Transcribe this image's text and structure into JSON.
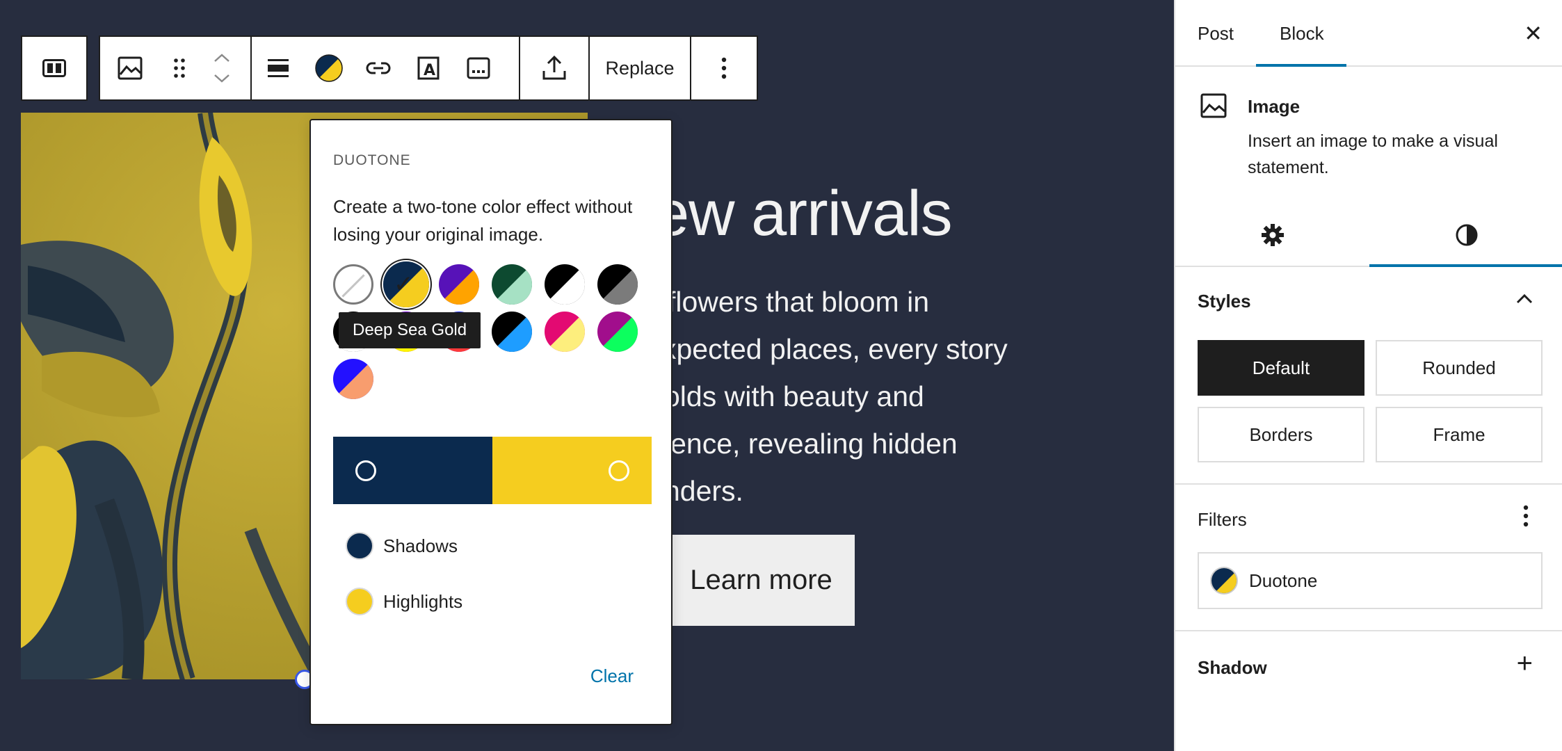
{
  "toolbar": {
    "replace_label": "Replace"
  },
  "hero": {
    "title": "ew arrivals",
    "lines": [
      "flowers that bloom in",
      "xpected places, every story",
      "olds with beauty and",
      "ience, revealing hidden",
      "nders."
    ],
    "button_label": "Learn more"
  },
  "duotone": {
    "heading": "DUOTONE",
    "description": "Create a two-tone color effect without losing your original image.",
    "tooltip": "Deep Sea Gold",
    "swatches": [
      {
        "name": "none",
        "a": "#ffffff",
        "b": "#ffffff"
      },
      {
        "name": "Deep Sea Gold",
        "a": "#0b2a4e",
        "b": "#f5cd1f",
        "selected": true
      },
      {
        "name": "purple-orange",
        "a": "#5712b8",
        "b": "#ffa300"
      },
      {
        "name": "green-mint",
        "a": "#0d4a30",
        "b": "#a6e1c4"
      },
      {
        "name": "black-white",
        "a": "#000000",
        "b": "#ffffff"
      },
      {
        "name": "black-gray",
        "a": "#000000",
        "b": "#7b7b7b"
      },
      {
        "name": "black-white-2",
        "a": "#000000",
        "b": "#ffffff"
      },
      {
        "name": "purple-yellow",
        "a": "#7a00df",
        "b": "#fef400"
      },
      {
        "name": "blue-red",
        "a": "#1b2cff",
        "b": "#ff3a3a"
      },
      {
        "name": "black-cyan",
        "a": "#000000",
        "b": "#1e9dff"
      },
      {
        "name": "magenta-yellow",
        "a": "#e30a72",
        "b": "#fdee7d"
      },
      {
        "name": "magenta-green",
        "a": "#a10e8c",
        "b": "#0cff5e"
      },
      {
        "name": "blue-peach",
        "a": "#2311ff",
        "b": "#f89d6e"
      }
    ],
    "shadows_color": "#0b2a4e",
    "highlights_color": "#f5cd1f",
    "shadows_label": "Shadows",
    "highlights_label": "Highlights",
    "clear_label": "Clear"
  },
  "sidebar": {
    "tab_post": "Post",
    "tab_block": "Block",
    "block_title": "Image",
    "block_desc": "Insert an image to make a visual statement.",
    "styles_title": "Styles",
    "styles": [
      "Default",
      "Rounded",
      "Borders",
      "Frame"
    ],
    "active_style": "Default",
    "filters_title": "Filters",
    "filter_item": "Duotone",
    "shadow_title": "Shadow"
  },
  "colors": {
    "accent": "#0073aa",
    "canvas_bg": "#272d3f"
  }
}
